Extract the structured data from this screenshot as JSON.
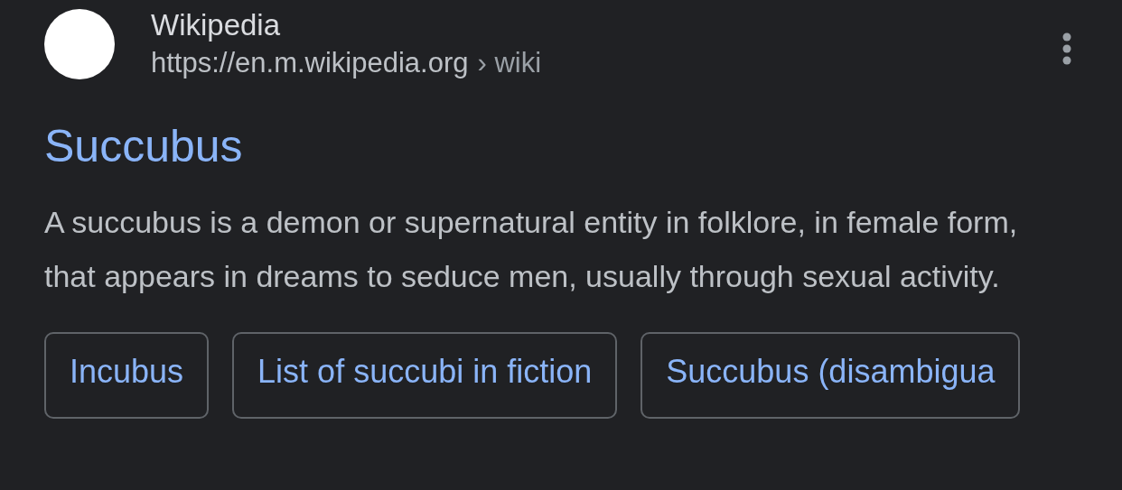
{
  "result": {
    "site_name": "Wikipedia",
    "url": "https://en.m.wikipedia.org",
    "breadcrumb": "› wiki",
    "title": "Succubus",
    "snippet": "A succubus is a demon or supernatural entity in folklore, in female form, that appears in dreams to seduce men, usually through sexual activity."
  },
  "related_links": [
    {
      "label": "Incubus"
    },
    {
      "label": "List of succubi in fiction"
    },
    {
      "label": "Succubus (disambigua"
    }
  ]
}
